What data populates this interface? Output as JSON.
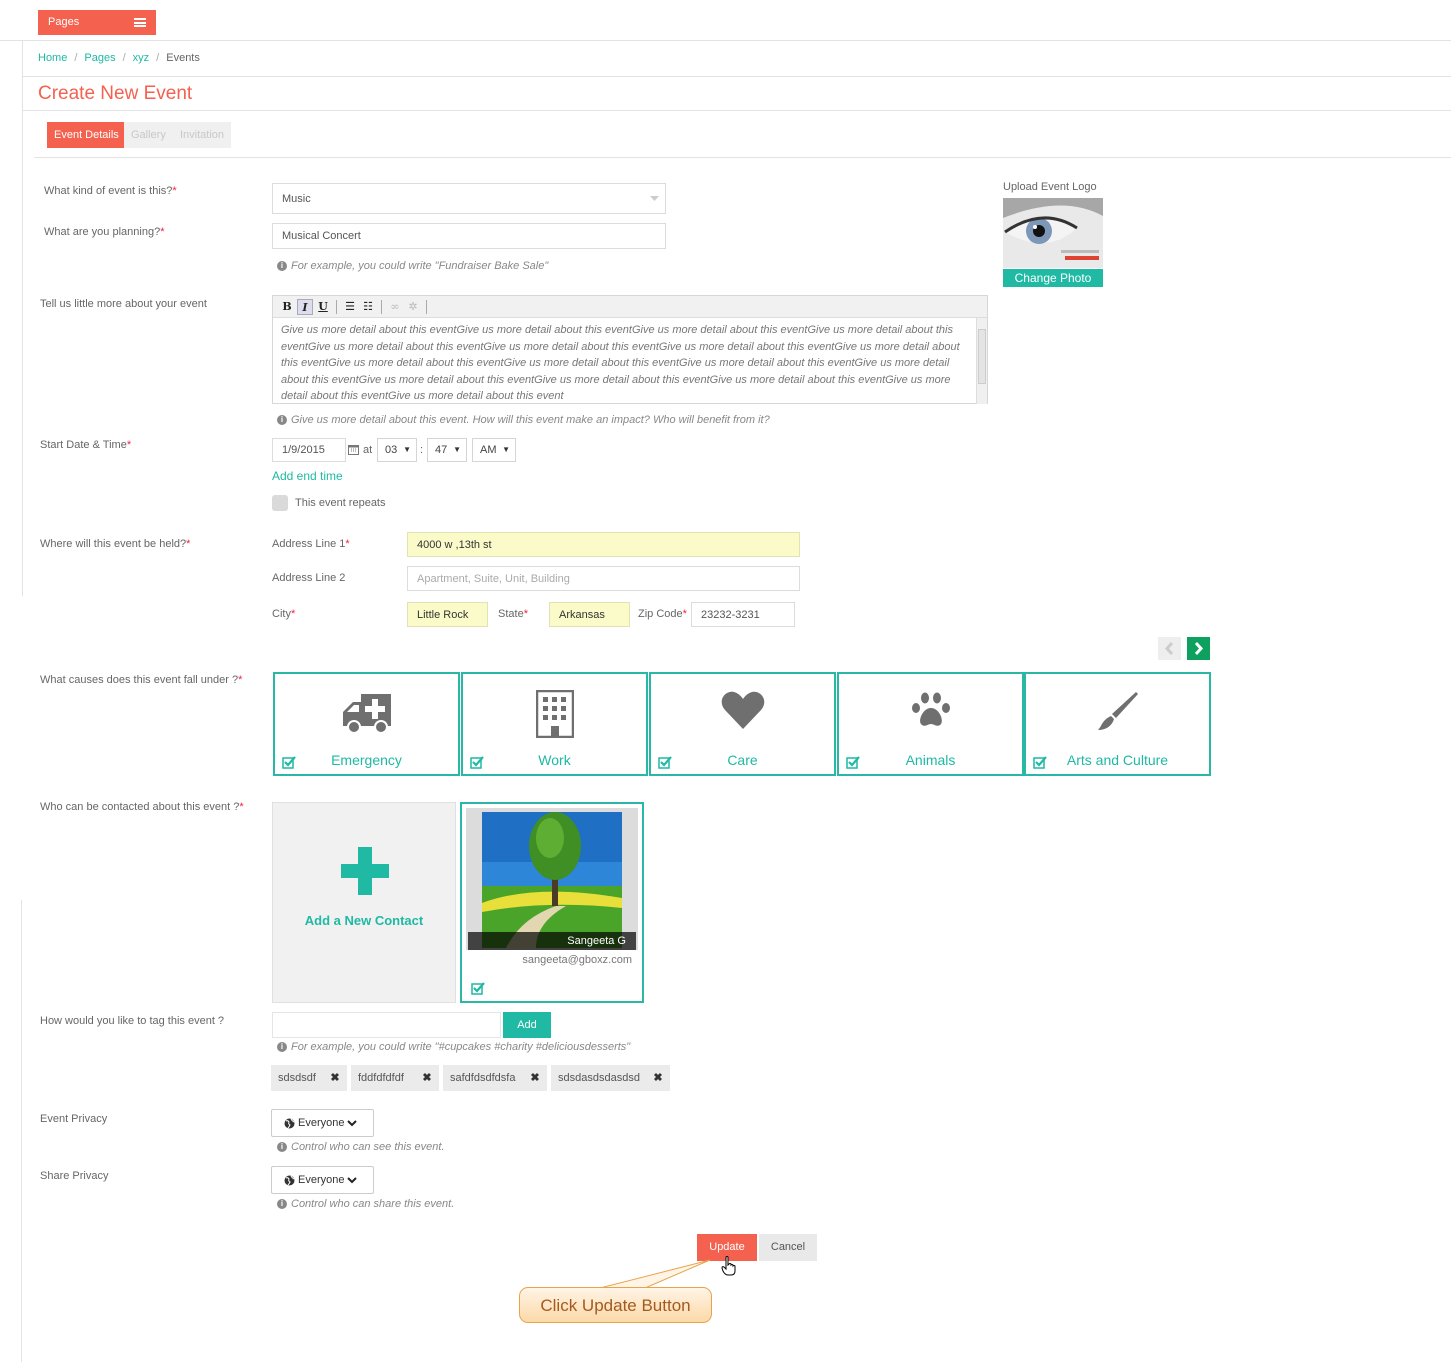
{
  "top_menu": {
    "label": "Pages"
  },
  "breadcrumb": [
    "Home",
    "Pages",
    "xyz",
    "Events"
  ],
  "page_title": "Create New Event",
  "tabs": [
    "Event Details",
    "Gallery",
    "Invitation"
  ],
  "form": {
    "event_kind": {
      "label": "What kind of event is this?",
      "value": "Music"
    },
    "planning": {
      "label": "What are you planning?",
      "value": "Musical Concert",
      "hint": "For example, you could write \"Fundraiser Bake Sale\""
    },
    "description": {
      "label": "Tell us little more about your event",
      "text": "Give us more detail about this eventGive us more detail about this eventGive us more detail about this eventGive us more detail about this eventGive us more detail about this eventGive us more detail about this eventGive us more detail about this eventGive us more detail about this eventGive us more detail about this eventGive us more detail about this eventGive us more detail about this eventGive us more detail about this eventGive us more detail about this eventGive us more detail about this eventGive us more detail about this eventGive us more detail about this eventGive us more detail about this event",
      "hint": "Give us more detail about this event. How will this event make an impact? Who will benefit from it?"
    },
    "start": {
      "label": "Start Date & Time",
      "date": "1/9/2015",
      "at": "at",
      "hour": "03",
      "colon": ":",
      "minute": "47",
      "ampm": "AM",
      "add_end_time": "Add end time",
      "repeats": "This event repeats"
    },
    "location": {
      "label": "Where will this event be held?",
      "address1_label": "Address Line 1",
      "address1": "4000 w ,13th st",
      "address2_label": "Address Line 2",
      "address2_placeholder": "Apartment, Suite, Unit, Building",
      "city_label": "City",
      "city": "Little Rock",
      "state_label": "State",
      "state": "Arkansas",
      "zip_label": "Zip Code",
      "zip": "23232-3231"
    },
    "causes": {
      "label": "What causes does this event fall under ?",
      "items": [
        "Emergency",
        "Work",
        "Care",
        "Animals",
        "Arts and Culture"
      ]
    },
    "contacts": {
      "label": "Who can be contacted about this event ?",
      "add_label": "Add a New Contact",
      "card_name": "Sangeeta G",
      "card_email": "sangeeta@gboxz.com"
    },
    "tags": {
      "label": "How would you like to tag this event ?",
      "add_button": "Add",
      "hint": "For example, you could write \"#cupcakes #charity #deliciousdesserts\"",
      "chips": [
        "sdsdsdf",
        "fddfdfdfdf",
        "safdfdsdfdsfa",
        "sdsdasdsdasdsd"
      ]
    },
    "event_privacy": {
      "label": "Event Privacy",
      "value": "Everyone",
      "hint": "Control who can see this event."
    },
    "share_privacy": {
      "label": "Share Privacy",
      "value": "Everyone",
      "hint": "Control who can share this event."
    }
  },
  "logo": {
    "label": "Upload Event Logo",
    "change_photo": "Change Photo"
  },
  "actions": {
    "update": "Update",
    "cancel": "Cancel"
  },
  "callout": "Click Update Button",
  "colors": {
    "accent": "#f4624f",
    "teal": "#1fb9a4",
    "highlight": "#fafbc8"
  }
}
